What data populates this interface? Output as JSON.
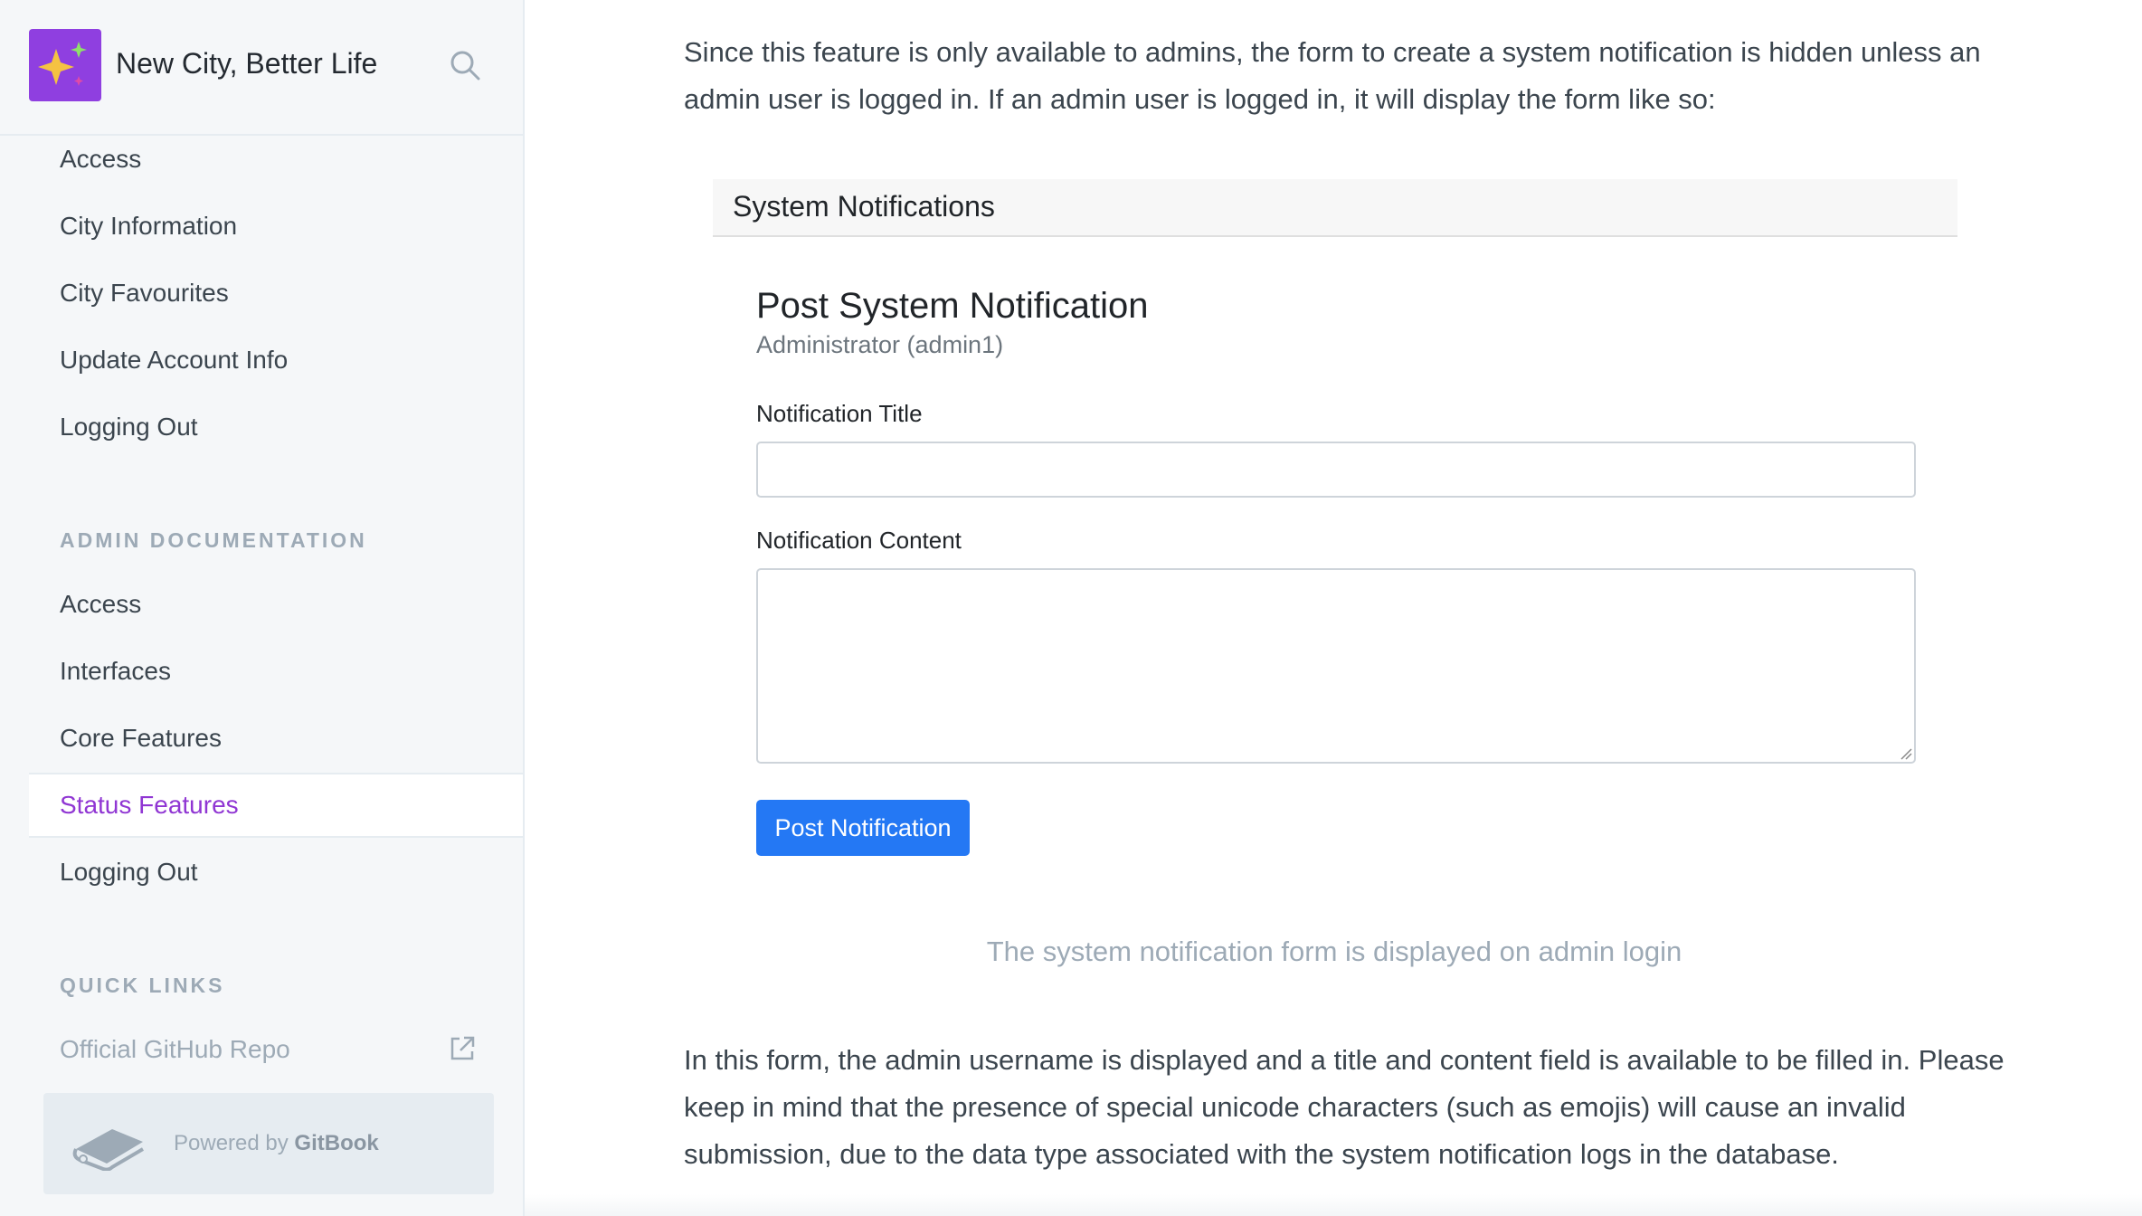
{
  "app": {
    "title": "New City, Better Life",
    "brand_color": "#8f3fe0",
    "accent_color": "#9036d3"
  },
  "sidebar": {
    "user_items": [
      {
        "label": "Access"
      },
      {
        "label": "City Information"
      },
      {
        "label": "City Favourites"
      },
      {
        "label": "Update Account Info"
      },
      {
        "label": "Logging Out"
      }
    ],
    "admin_heading": "ADMIN DOCUMENTATION",
    "admin_items": [
      {
        "label": "Access",
        "active": false
      },
      {
        "label": "Interfaces",
        "active": false
      },
      {
        "label": "Core Features",
        "active": false
      },
      {
        "label": "Status Features",
        "active": true
      },
      {
        "label": "Logging Out",
        "active": false
      }
    ],
    "quick_links_heading": "QUICK LINKS",
    "quick_links": [
      {
        "label": "Official GitHub Repo",
        "icon": "external-link-icon"
      }
    ],
    "footer": {
      "powered_by": "Powered by ",
      "brand": "GitBook"
    }
  },
  "main": {
    "intro_paragraph": "Since this feature is only available to admins, the form to create a system notification is hidden unless an admin user is logged in. If an admin user is logged in, it will display the form like so:",
    "figure": {
      "card_header": "System Notifications",
      "form_title": "Post System Notification",
      "form_subtitle": "Administrator (admin1)",
      "title_label": "Notification Title",
      "title_value": "",
      "content_label": "Notification Content",
      "content_value": "",
      "submit_label": "Post Notification",
      "button_color": "#2478f4"
    },
    "caption": "The system notification form is displayed on admin login",
    "closing_paragraph": "In this form, the admin username is displayed and a title and content field is available to be filled in. Please keep in mind that the presence of special unicode characters (such as emojis) will cause an invalid submission, due to the data type associated with the system notification logs in the database."
  }
}
